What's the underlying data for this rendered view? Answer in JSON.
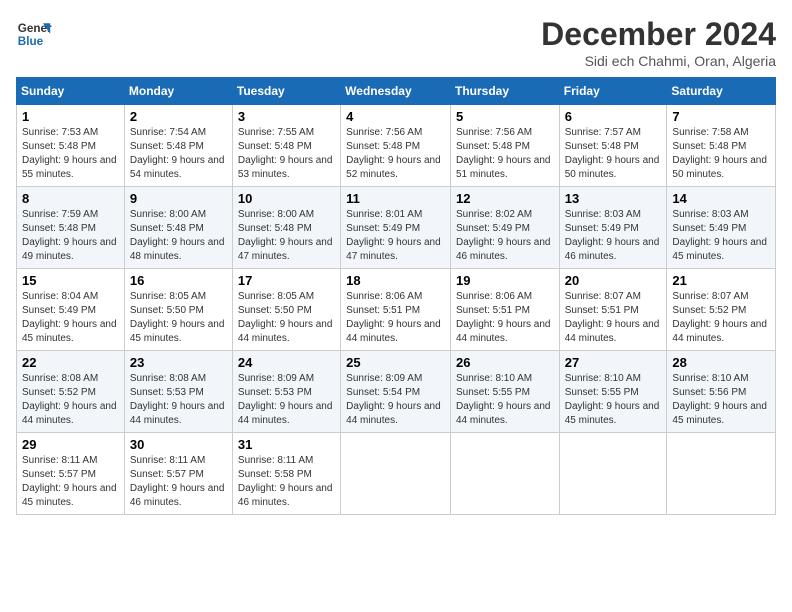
{
  "logo": {
    "line1": "General",
    "line2": "Blue"
  },
  "title": "December 2024",
  "subtitle": "Sidi ech Chahmi, Oran, Algeria",
  "days_of_week": [
    "Sunday",
    "Monday",
    "Tuesday",
    "Wednesday",
    "Thursday",
    "Friday",
    "Saturday"
  ],
  "weeks": [
    [
      {
        "day": "1",
        "sunrise": "Sunrise: 7:53 AM",
        "sunset": "Sunset: 5:48 PM",
        "daylight": "Daylight: 9 hours and 55 minutes."
      },
      {
        "day": "2",
        "sunrise": "Sunrise: 7:54 AM",
        "sunset": "Sunset: 5:48 PM",
        "daylight": "Daylight: 9 hours and 54 minutes."
      },
      {
        "day": "3",
        "sunrise": "Sunrise: 7:55 AM",
        "sunset": "Sunset: 5:48 PM",
        "daylight": "Daylight: 9 hours and 53 minutes."
      },
      {
        "day": "4",
        "sunrise": "Sunrise: 7:56 AM",
        "sunset": "Sunset: 5:48 PM",
        "daylight": "Daylight: 9 hours and 52 minutes."
      },
      {
        "day": "5",
        "sunrise": "Sunrise: 7:56 AM",
        "sunset": "Sunset: 5:48 PM",
        "daylight": "Daylight: 9 hours and 51 minutes."
      },
      {
        "day": "6",
        "sunrise": "Sunrise: 7:57 AM",
        "sunset": "Sunset: 5:48 PM",
        "daylight": "Daylight: 9 hours and 50 minutes."
      },
      {
        "day": "7",
        "sunrise": "Sunrise: 7:58 AM",
        "sunset": "Sunset: 5:48 PM",
        "daylight": "Daylight: 9 hours and 50 minutes."
      }
    ],
    [
      {
        "day": "8",
        "sunrise": "Sunrise: 7:59 AM",
        "sunset": "Sunset: 5:48 PM",
        "daylight": "Daylight: 9 hours and 49 minutes."
      },
      {
        "day": "9",
        "sunrise": "Sunrise: 8:00 AM",
        "sunset": "Sunset: 5:48 PM",
        "daylight": "Daylight: 9 hours and 48 minutes."
      },
      {
        "day": "10",
        "sunrise": "Sunrise: 8:00 AM",
        "sunset": "Sunset: 5:48 PM",
        "daylight": "Daylight: 9 hours and 47 minutes."
      },
      {
        "day": "11",
        "sunrise": "Sunrise: 8:01 AM",
        "sunset": "Sunset: 5:49 PM",
        "daylight": "Daylight: 9 hours and 47 minutes."
      },
      {
        "day": "12",
        "sunrise": "Sunrise: 8:02 AM",
        "sunset": "Sunset: 5:49 PM",
        "daylight": "Daylight: 9 hours and 46 minutes."
      },
      {
        "day": "13",
        "sunrise": "Sunrise: 8:03 AM",
        "sunset": "Sunset: 5:49 PM",
        "daylight": "Daylight: 9 hours and 46 minutes."
      },
      {
        "day": "14",
        "sunrise": "Sunrise: 8:03 AM",
        "sunset": "Sunset: 5:49 PM",
        "daylight": "Daylight: 9 hours and 45 minutes."
      }
    ],
    [
      {
        "day": "15",
        "sunrise": "Sunrise: 8:04 AM",
        "sunset": "Sunset: 5:49 PM",
        "daylight": "Daylight: 9 hours and 45 minutes."
      },
      {
        "day": "16",
        "sunrise": "Sunrise: 8:05 AM",
        "sunset": "Sunset: 5:50 PM",
        "daylight": "Daylight: 9 hours and 45 minutes."
      },
      {
        "day": "17",
        "sunrise": "Sunrise: 8:05 AM",
        "sunset": "Sunset: 5:50 PM",
        "daylight": "Daylight: 9 hours and 44 minutes."
      },
      {
        "day": "18",
        "sunrise": "Sunrise: 8:06 AM",
        "sunset": "Sunset: 5:51 PM",
        "daylight": "Daylight: 9 hours and 44 minutes."
      },
      {
        "day": "19",
        "sunrise": "Sunrise: 8:06 AM",
        "sunset": "Sunset: 5:51 PM",
        "daylight": "Daylight: 9 hours and 44 minutes."
      },
      {
        "day": "20",
        "sunrise": "Sunrise: 8:07 AM",
        "sunset": "Sunset: 5:51 PM",
        "daylight": "Daylight: 9 hours and 44 minutes."
      },
      {
        "day": "21",
        "sunrise": "Sunrise: 8:07 AM",
        "sunset": "Sunset: 5:52 PM",
        "daylight": "Daylight: 9 hours and 44 minutes."
      }
    ],
    [
      {
        "day": "22",
        "sunrise": "Sunrise: 8:08 AM",
        "sunset": "Sunset: 5:52 PM",
        "daylight": "Daylight: 9 hours and 44 minutes."
      },
      {
        "day": "23",
        "sunrise": "Sunrise: 8:08 AM",
        "sunset": "Sunset: 5:53 PM",
        "daylight": "Daylight: 9 hours and 44 minutes."
      },
      {
        "day": "24",
        "sunrise": "Sunrise: 8:09 AM",
        "sunset": "Sunset: 5:53 PM",
        "daylight": "Daylight: 9 hours and 44 minutes."
      },
      {
        "day": "25",
        "sunrise": "Sunrise: 8:09 AM",
        "sunset": "Sunset: 5:54 PM",
        "daylight": "Daylight: 9 hours and 44 minutes."
      },
      {
        "day": "26",
        "sunrise": "Sunrise: 8:10 AM",
        "sunset": "Sunset: 5:55 PM",
        "daylight": "Daylight: 9 hours and 44 minutes."
      },
      {
        "day": "27",
        "sunrise": "Sunrise: 8:10 AM",
        "sunset": "Sunset: 5:55 PM",
        "daylight": "Daylight: 9 hours and 45 minutes."
      },
      {
        "day": "28",
        "sunrise": "Sunrise: 8:10 AM",
        "sunset": "Sunset: 5:56 PM",
        "daylight": "Daylight: 9 hours and 45 minutes."
      }
    ],
    [
      {
        "day": "29",
        "sunrise": "Sunrise: 8:11 AM",
        "sunset": "Sunset: 5:57 PM",
        "daylight": "Daylight: 9 hours and 45 minutes."
      },
      {
        "day": "30",
        "sunrise": "Sunrise: 8:11 AM",
        "sunset": "Sunset: 5:57 PM",
        "daylight": "Daylight: 9 hours and 46 minutes."
      },
      {
        "day": "31",
        "sunrise": "Sunrise: 8:11 AM",
        "sunset": "Sunset: 5:58 PM",
        "daylight": "Daylight: 9 hours and 46 minutes."
      },
      null,
      null,
      null,
      null
    ]
  ]
}
